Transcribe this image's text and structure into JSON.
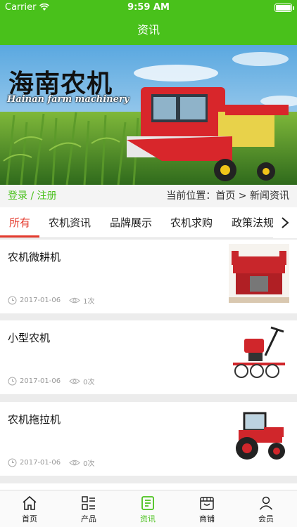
{
  "status": {
    "carrier": "Carrier",
    "time": "9:59 AM"
  },
  "nav": {
    "title": "资讯"
  },
  "banner": {
    "title": "海南农机",
    "subtitle": "Hainan farm machinery"
  },
  "location": {
    "login": "登录",
    "separator": "/",
    "register": "注册",
    "breadcrumb": "当前位置：首页 > 新闻资讯"
  },
  "tabs": [
    {
      "label": "所有",
      "active": true
    },
    {
      "label": "农机资讯",
      "active": false
    },
    {
      "label": "品牌展示",
      "active": false
    },
    {
      "label": "农机求购",
      "active": false
    },
    {
      "label": "政策法规",
      "active": false
    }
  ],
  "news": [
    {
      "title": "农机微耕机",
      "date": "2017-01-06",
      "views": "1次",
      "thumb": "micro-tiller-image"
    },
    {
      "title": "小型农机",
      "date": "2017-01-06",
      "views": "0次",
      "thumb": "small-rotary-tiller-image"
    },
    {
      "title": "农机拖拉机",
      "date": "2017-01-06",
      "views": "0次",
      "thumb": "red-tractor-image"
    }
  ],
  "tabbar": [
    {
      "label": "首页",
      "icon": "home-icon",
      "active": false
    },
    {
      "label": "产品",
      "icon": "product-list-icon",
      "active": false
    },
    {
      "label": "资讯",
      "icon": "news-document-icon",
      "active": true
    },
    {
      "label": "商铺",
      "icon": "shop-icon",
      "active": false
    },
    {
      "label": "会员",
      "icon": "member-icon",
      "active": false
    }
  ],
  "colors": {
    "brand": "#49c11b",
    "accent": "#e43a2d"
  }
}
